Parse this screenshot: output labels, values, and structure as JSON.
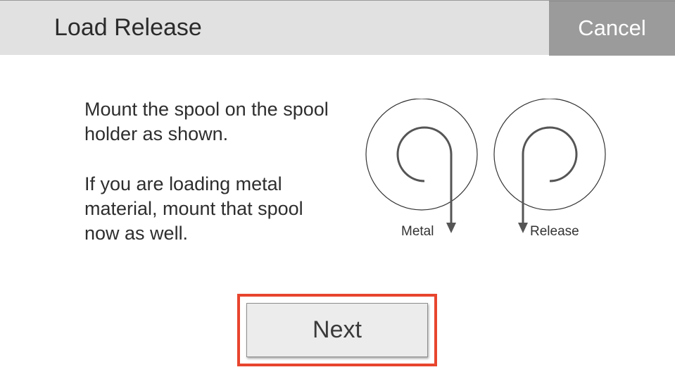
{
  "header": {
    "title": "Load Release",
    "cancel_label": "Cancel"
  },
  "instructions": {
    "paragraph_1": "Mount the spool on the spool holder as shown.",
    "paragraph_2": "If you are loading metal material, mount that spool now as well."
  },
  "diagram": {
    "left_spool_label": "Metal",
    "right_spool_label": "Release"
  },
  "actions": {
    "next_label": "Next"
  },
  "colors": {
    "header_bg": "#e1e1e1",
    "cancel_bg": "#9b9b9b",
    "highlight": "#e8452e"
  }
}
